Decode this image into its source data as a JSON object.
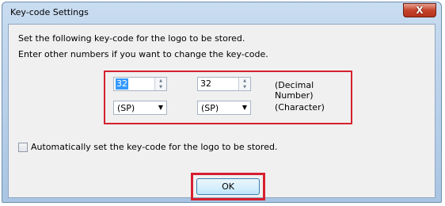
{
  "window": {
    "title": "Key-code Settings",
    "close_label": "X"
  },
  "instructions": {
    "line1": "Set the following key-code for the logo to be stored.",
    "line2": "Enter other numbers if you want to change the key-code."
  },
  "keycode": {
    "decimal_1": "32",
    "decimal_2": "32",
    "decimal_label": "(Decimal Number)",
    "char_1": "(SP)",
    "char_2": "(SP)",
    "char_label": "(Character)"
  },
  "auto_set": {
    "label": "Automatically set the key-code for the logo to be stored.",
    "checked": false
  },
  "ok_label": "OK",
  "colors": {
    "highlight": "#d6202f",
    "selection": "#3399ff"
  },
  "icons": {
    "close": "close-icon",
    "spin_up": "spin-up-icon",
    "spin_down": "spin-down-icon",
    "dropdown": "chevron-down-icon"
  }
}
